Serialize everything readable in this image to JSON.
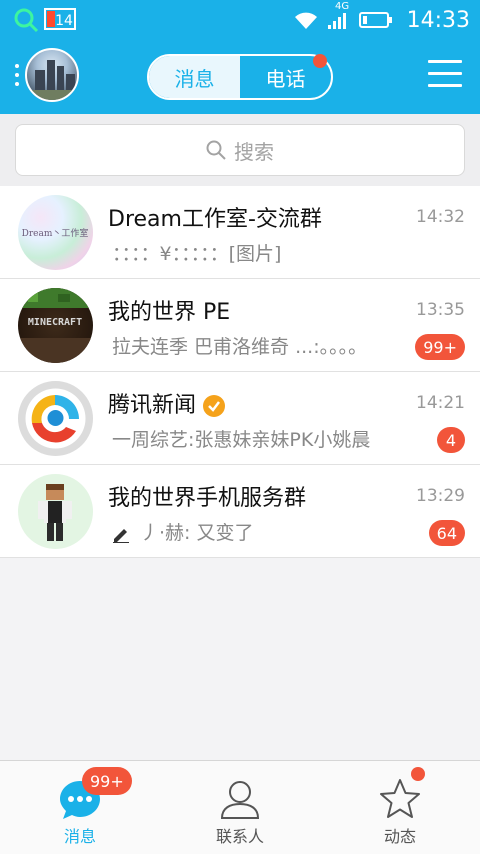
{
  "status_bar": {
    "network": "4G",
    "time": "14:33",
    "battery_indicator": "14"
  },
  "header": {
    "tabs": [
      {
        "label": "消息",
        "active": true
      },
      {
        "label": "电话",
        "active": false,
        "has_dot": true
      }
    ]
  },
  "search": {
    "placeholder": "搜索"
  },
  "conversations": [
    {
      "title": "Dream工作室-交流群",
      "time": "14:32",
      "preview": "：：：：¥：：：：：[图片]",
      "badge": "",
      "avatar_text": "Dream丶工作室"
    },
    {
      "title": "我的世界 PE",
      "time": "13:35",
      "preview": "拉夫连季 巴甫洛维奇 ...:。。。。",
      "badge": "99+",
      "avatar_text": "MINECRAFT"
    },
    {
      "title": "腾讯新闻",
      "time": "14:21",
      "preview": "一周综艺:张惠妹亲妹PK小姚晨",
      "badge": "4",
      "verified": true
    },
    {
      "title": "我的世界手机服务群",
      "time": "13:29",
      "preview": "丿·赫: 又变了",
      "badge": "64",
      "draft_icon": "pencil-icon"
    }
  ],
  "bottom_nav": [
    {
      "label": "消息",
      "icon": "chat-bubble-icon",
      "active": true,
      "badge": "99+"
    },
    {
      "label": "联系人",
      "icon": "contacts-icon",
      "active": false
    },
    {
      "label": "动态",
      "icon": "star-icon",
      "active": false,
      "has_dot": true
    }
  ],
  "colors": {
    "accent": "#1ab1e8",
    "badge": "#f2553a"
  }
}
